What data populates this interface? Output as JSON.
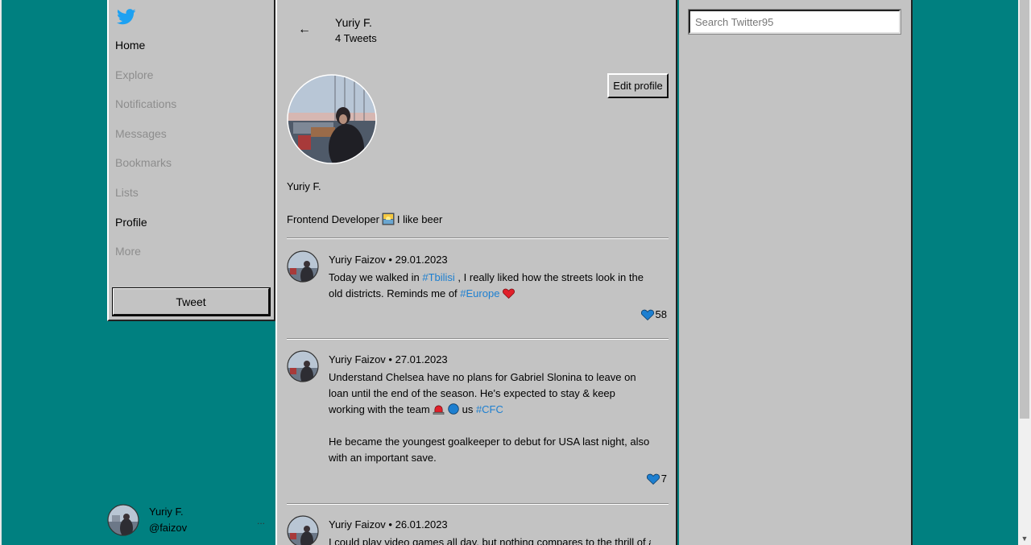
{
  "sidebar": {
    "logo": "twitter-bird-icon",
    "items": [
      {
        "label": "Home",
        "enabled": true
      },
      {
        "label": "Explore",
        "enabled": false
      },
      {
        "label": "Notifications",
        "enabled": false
      },
      {
        "label": "Messages",
        "enabled": false
      },
      {
        "label": "Bookmarks",
        "enabled": false
      },
      {
        "label": "Lists",
        "enabled": false
      },
      {
        "label": "Profile",
        "enabled": true
      },
      {
        "label": "More",
        "enabled": false
      }
    ],
    "tweet_label": "Tweet"
  },
  "account": {
    "name": "Yuriy F.",
    "handle": "@faizov",
    "more": "..."
  },
  "header": {
    "back": "←",
    "name": "Yuriy F.",
    "count": "4 Tweets"
  },
  "profile": {
    "edit_label": "Edit profile",
    "name": "Yuriy F.",
    "bio_before": "Frontend Developer",
    "bio_emoji": "sunrise-emoji",
    "bio_after": "I like beer"
  },
  "tweets": [
    {
      "author": "Yuriy Faizov",
      "date": "29.01.2023",
      "text1": "Today we walked in ",
      "tag1": "#Tbilisi",
      "text2": " , I really liked how the streets look in the old districts. Reminds me of ",
      "tag2": "#Europe",
      "likes": "58"
    },
    {
      "author": "Yuriy Faizov",
      "date": "27.01.2023",
      "text1": "Understand Chelsea have no plans for Gabriel Slonina to leave on loan until the end of the season. He's expected to stay & keep working with the team ",
      "text_us": "us ",
      "tag1": "#CFC",
      "text3": "He became the youngest goalkeeper to debut for USA last night, also with an important save.",
      "likes": "7"
    },
    {
      "author": "Yuriy Faizov",
      "date": "26.01.2023",
      "text1": "I could play video games all day, but nothing compares to the thrill of a real"
    }
  ],
  "search": {
    "placeholder": "Search Twitter95"
  },
  "colors": {
    "desktop": "#008080",
    "panel": "#c3c3c3",
    "hashtag": "#1d7fd0",
    "like": "#1d7fd0",
    "twitter_blue": "#1da1f2"
  }
}
